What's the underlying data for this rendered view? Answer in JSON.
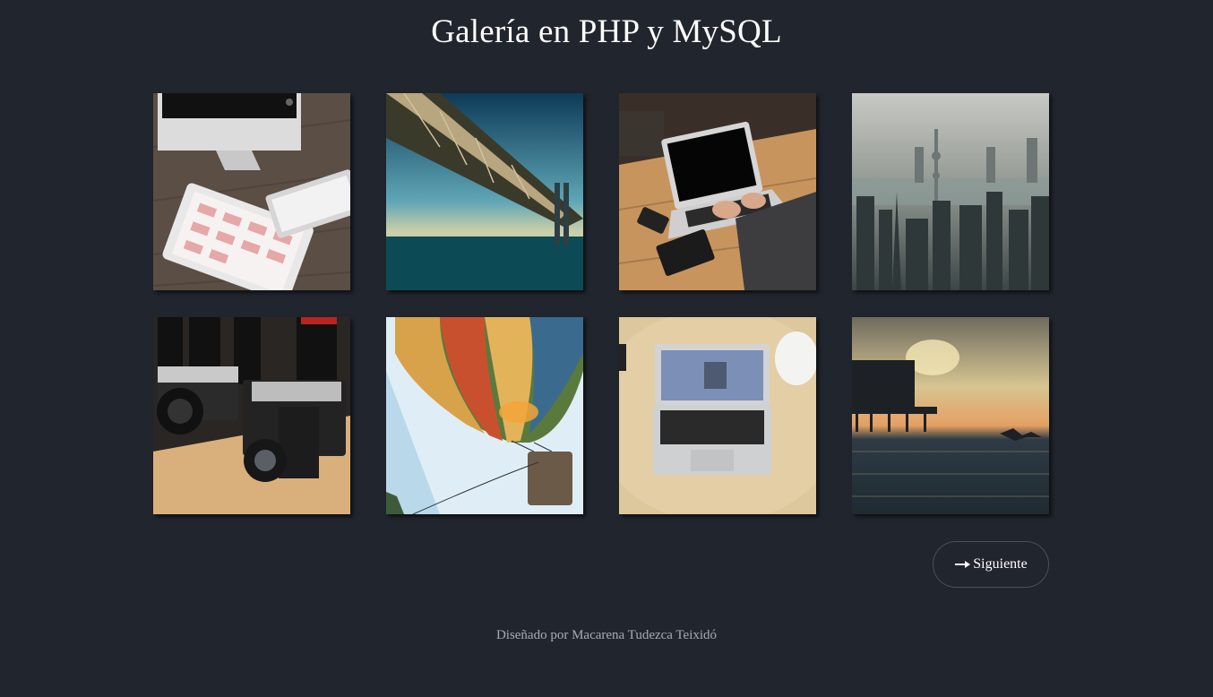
{
  "page": {
    "title": "Galería en PHP y MySQL",
    "footer": "Diseñado por Macarena Tudezca Teixidó"
  },
  "gallery": {
    "images": [
      {
        "subject": "imac-ipad-keyboard-desk"
      },
      {
        "subject": "suspension-bridge-over-sea"
      },
      {
        "subject": "laptop-typing-wooden-table"
      },
      {
        "subject": "foggy-city-skyline"
      },
      {
        "subject": "vintage-cameras-lenses"
      },
      {
        "subject": "hot-air-balloon"
      },
      {
        "subject": "macbook-air-on-table"
      },
      {
        "subject": "pier-sunset-seagull"
      }
    ]
  },
  "pagination": {
    "next_label": "Siguiente",
    "next_icon": "arrow-right-icon"
  },
  "colors": {
    "background": "#21252d",
    "button_border": "#4a4f58",
    "footer_text": "#a9abb0"
  }
}
